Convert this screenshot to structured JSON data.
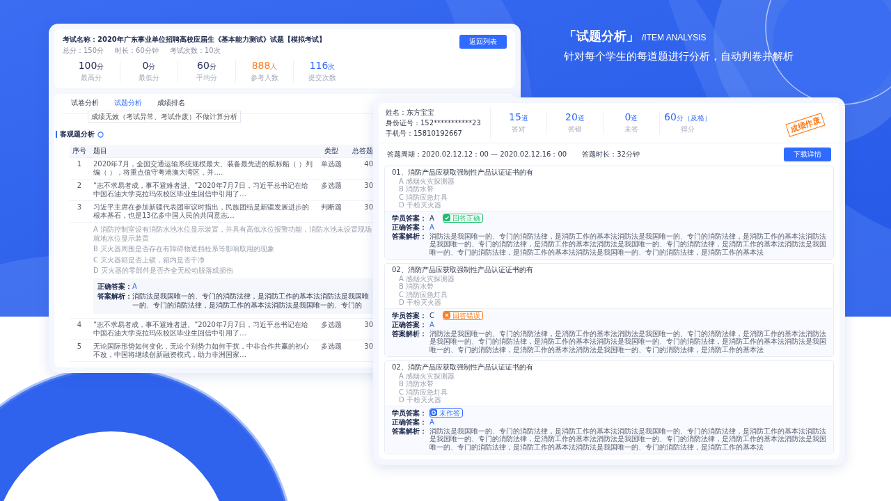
{
  "heading": {
    "title": "「试题分析」",
    "subtitle": "/ITEM ANALYSIS",
    "description": "针对每个学生的每道题进行分析，自动判卷并解析"
  },
  "exam": {
    "title": "考试名称：2020年广东事业单位招聘高校应届生《基本能力测试》试题【模拟考试】",
    "meta": [
      "总分：150分",
      "时长：60分钟",
      "考试次数：10次"
    ],
    "back_button": "返回列表",
    "stats": [
      {
        "value": "100",
        "unit": "分",
        "label": "最高分",
        "color": "#1f2a4d"
      },
      {
        "value": "0",
        "unit": "分",
        "label": "最低分",
        "color": "#1f2a4d"
      },
      {
        "value": "60",
        "unit": "分",
        "label": "平均分",
        "color": "#1f2a4d"
      },
      {
        "value": "888",
        "unit": "人",
        "label": "参考人数",
        "color": "#ff7a1a"
      },
      {
        "value": "116",
        "unit": "次",
        "label": "提交次数",
        "color": "#2f6bff"
      }
    ]
  },
  "tabs": [
    {
      "label": "试卷分析",
      "selected": false
    },
    {
      "label": "试题分析",
      "selected": true
    },
    {
      "label": "成绩排名",
      "selected": false
    }
  ],
  "tooltip": "成绩无效（考试异常、考试作废）不做计算分析",
  "section_title": "客观题分析",
  "table": {
    "columns": [
      "序号",
      "题目",
      "类型",
      "总答题"
    ],
    "rows": [
      {
        "index": "1",
        "question": "2020年7月，全国交通运输系统规模最大、装备最先进的航标船（ ）列编（ ），将重点值守粤港澳大湾区，并….",
        "type": "单选题",
        "count": "40"
      },
      {
        "index": "2",
        "question": "“志不求易者成，事不避难者进。”2020年7月7日，习近平总书记在给中国石油大学克拉玛依校区毕业生回信中引用了…",
        "type": "多选题",
        "count": "30"
      },
      {
        "index": "3",
        "question": "习近平主席在参加新疆代表团审议时指出，民族团结是新疆发展进步的根本基石，也是13亿多中国人民的共同意志…",
        "type": "判断题",
        "count": "30",
        "options": [
          "A 消防控制室设有消防水池水位显示装置，并具有高低水位报警功能，消防水池未设置现场就地水位显示装置",
          "B 灭火器周围是否存在有障碍物遮挡栓系等影响取用的现象",
          "C 灭火器箱是否上锁，箱内是否干净",
          "D 灭火器的零部件是否齐全无松动脱落或损伤"
        ],
        "answer_label": "正确答案：",
        "answer": "A",
        "analysis_label": "答案解析：",
        "analysis": "消防法是我国唯一的、专门的消防法律，是消防工作的基本法消防法是我国唯一的、专门的消防法律，是消防工作的基本法消防法是我国唯一的、专门的"
      },
      {
        "index": "4",
        "question": "“志不求易者成，事不避难者进。”2020年7月7日，习近平总书记在给中国石油大学克拉玛依校区毕业生回信中引用了…",
        "type": "多选题",
        "count": "30"
      },
      {
        "index": "5",
        "question": "无论国际形势如何变化，无论个别势力如何干扰，中非合作共赢的初心不改，中国将继续创新融资模式，助力非洲国家…",
        "type": "多选题",
        "count": "30"
      }
    ]
  },
  "student": {
    "fields": [
      "姓名：东方宝宝",
      "身份证号：152***********23",
      "手机号：15810192667"
    ],
    "stats": [
      {
        "value": "15",
        "unit": "道",
        "label": "答对"
      },
      {
        "value": "20",
        "unit": "道",
        "label": "答错"
      },
      {
        "value": "0",
        "unit": "道",
        "label": "未答"
      },
      {
        "value": "60",
        "unit": "分",
        "note": "（及格）",
        "label": "得分"
      }
    ],
    "stamp": "成绩作废",
    "period": "答题周期：2020.02.12.12：00 — 2020.02.12.16：00",
    "duration": "答题时长：32分钟",
    "download_button": "下载详情"
  },
  "questions": [
    {
      "title": "01、消防产品应获取强制性产品认证证书的有",
      "options": [
        "A 感烟火灾探测器",
        "B 消防水带",
        "C 消防应急灯具",
        "D 干粉灭火器"
      ],
      "student_label": "学员答案：",
      "student_answer": "A",
      "result": {
        "kind": "correct",
        "label": "回答正确"
      },
      "correct_label": "正确答案：",
      "correct_answer": "A",
      "analysis_label": "答案解析：",
      "analysis": "消防法是我国唯一的、专门的消防法律，是消防工作的基本法消防法是我国唯一的、专门的消防法律，是消防工作的基本法消防法是我国唯一的、专门的消防法律，是消防工作的基本法消防法是我国唯一的、专门的消防法律，是消防工作的基本法消防法是我国唯一的、专门的消防法律，是消防工作的基本法消防法是我国唯一的、专门的消防法律，是消防工作的基本法"
    },
    {
      "title": "02、消防产品应获取强制性产品认证证书的有",
      "options": [
        "A 感烟火灾探测器",
        "B 消防水带",
        "C 消防应急灯具",
        "D 干粉灭火器"
      ],
      "student_label": "学员答案：",
      "student_answer": "C",
      "result": {
        "kind": "wrong",
        "label": "回答错误"
      },
      "correct_label": "正确答案：",
      "correct_answer": "A",
      "analysis_label": "答案解析：",
      "analysis": "消防法是我国唯一的、专门的消防法律，是消防工作的基本法消防法是我国唯一的、专门的消防法律，是消防工作的基本法消防法是我国唯一的、专门的消防法律，是消防工作的基本法消防法是我国唯一的、专门的消防法律，是消防工作的基本法消防法是我国唯一的、专门的消防法律，是消防工作的基本法消防法是我国唯一的、专门的消防法律，是消防工作的基本法"
    },
    {
      "title": "02、消防产品应获取强制性产品认证证书的有",
      "options": [
        "A 感烟火灾探测器",
        "B 消防水带",
        "C 消防应急灯具",
        "D 干粉灭火器"
      ],
      "student_label": "学员答案：",
      "result": {
        "kind": "unanswered",
        "label": "未作答"
      },
      "correct_label": "正确答案：",
      "correct_answer": "A",
      "analysis_label": "答案解析：",
      "analysis": "消防法是我国唯一的、专门的消防法律，是消防工作的基本法消防法是我国唯一的、专门的消防法律，是消防工作的基本法消防法是我国唯一的、专门的消防法律，是消防工作的基本法消防法是我国唯一的、专门的消防法律，是消防工作的基本法消防法是我国唯一的、专门的消防法律，是消防工作的基本法消防法是我国唯一的、专门的消防法律，是消防工作的基本法"
    }
  ]
}
